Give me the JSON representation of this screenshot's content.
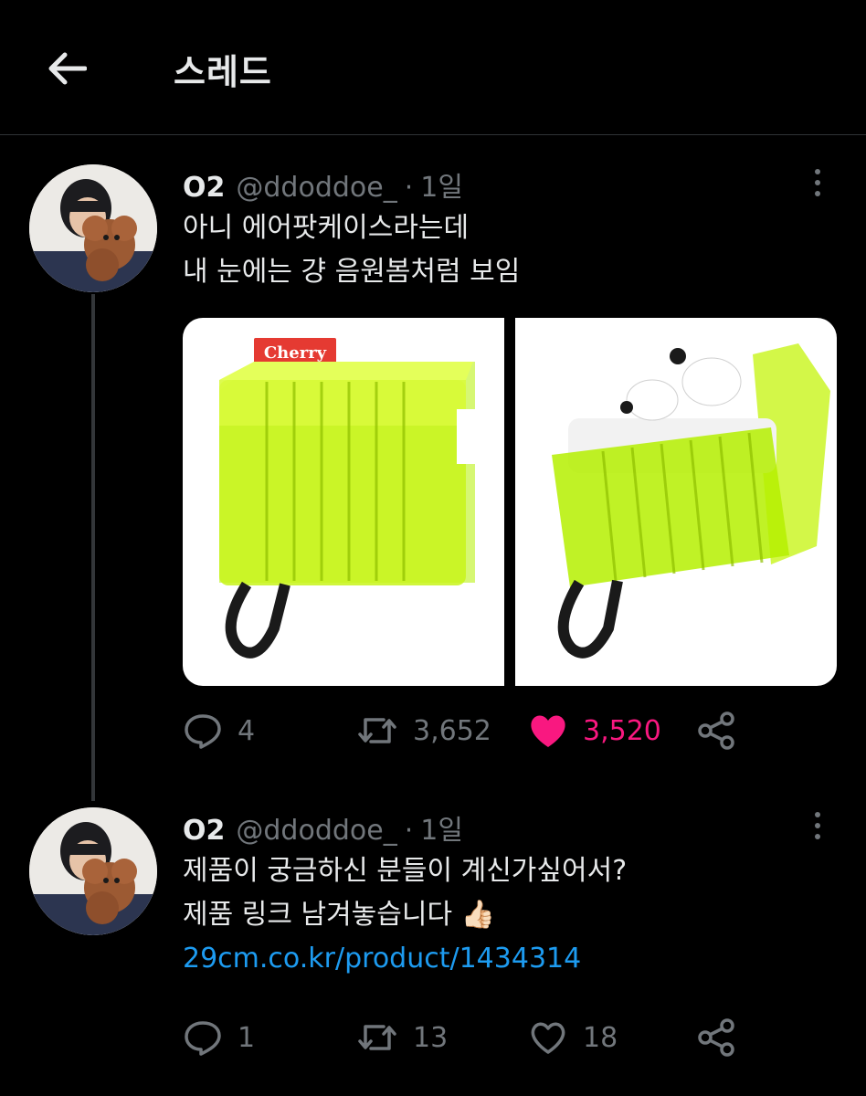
{
  "header": {
    "title": "스레드",
    "back_icon": "arrow-left-icon"
  },
  "colors": {
    "background": "#000000",
    "text": "#e7e9ea",
    "muted": "#71767b",
    "link": "#1d9bf0",
    "like_active": "#f91880",
    "case_green": "#b5f000"
  },
  "tweets": [
    {
      "name": "O2",
      "handle": "@ddoddoe_",
      "dot": "·",
      "time": "1일",
      "lines": [
        "아니 에어팟케이스라는데",
        "내 눈에는 걍 음원봄처럼 보임"
      ],
      "media": [
        {
          "label": "Cherry",
          "description": "closed neon green case"
        },
        {
          "description": "open neon green case with earbuds"
        }
      ],
      "actions": {
        "replies": "4",
        "retweets": "3,652",
        "likes": "3,520",
        "liked": true
      }
    },
    {
      "name": "O2",
      "handle": "@ddoddoe_",
      "dot": "·",
      "time": "1일",
      "lines": [
        "제품이 궁금하신 분들이 계신가싶어서?",
        "제품 링크 남겨놓습니다 👍🏻"
      ],
      "link": "29cm.co.kr/product/1434314",
      "actions": {
        "replies": "1",
        "retweets": "13",
        "likes": "18",
        "liked": false
      }
    }
  ]
}
